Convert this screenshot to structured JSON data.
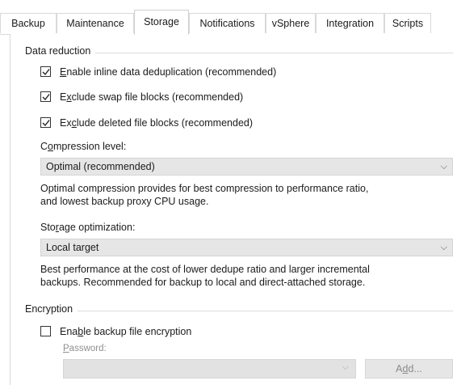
{
  "tabs": [
    {
      "label": "Backup"
    },
    {
      "label": "Maintenance"
    },
    {
      "label": "Storage",
      "active": true
    },
    {
      "label": "Notifications"
    },
    {
      "label": "vSphere"
    },
    {
      "label": "Integration"
    },
    {
      "label": "Scripts"
    }
  ],
  "data_reduction": {
    "title": "Data reduction",
    "dedup": {
      "pre": "",
      "ul": "E",
      "post": "nable inline data deduplication (recommended)",
      "checked": true
    },
    "swap": {
      "pre": "E",
      "ul": "x",
      "post": "clude swap file blocks (recommended)",
      "checked": true
    },
    "deleted": {
      "pre": "Ex",
      "ul": "c",
      "post": "lude deleted file blocks (recommended)",
      "checked": true
    },
    "compression_label": {
      "pre": "C",
      "ul": "o",
      "post": "mpression level:"
    },
    "compression_value": "Optimal (recommended)",
    "compression_desc_1": "Optimal compression provides for best compression to performance ratio,",
    "compression_desc_2": "and lowest backup proxy CPU usage.",
    "storage_label": {
      "pre": "Sto",
      "ul": "r",
      "post": "age optimization:"
    },
    "storage_value": "Local target",
    "storage_desc_1": "Best performance at the cost of lower dedupe ratio and larger incremental",
    "storage_desc_2": "backups. Recommended for backup to local and direct-attached storage."
  },
  "encryption": {
    "title": "Encryption",
    "enable": {
      "pre": "Ena",
      "ul": "b",
      "post": "le backup file encryption",
      "checked": false
    },
    "password_label": {
      "pre": "",
      "ul": "P",
      "post": "assword:"
    },
    "add_button": {
      "pre": "A",
      "ul": "d",
      "post": "d..."
    }
  },
  "icons": {
    "dropdown": "chevron-down-icon",
    "check": "checkmark-icon"
  },
  "colors": {
    "disabled_text": "#8f8f8f",
    "select_bg": "#e6e6e6"
  }
}
